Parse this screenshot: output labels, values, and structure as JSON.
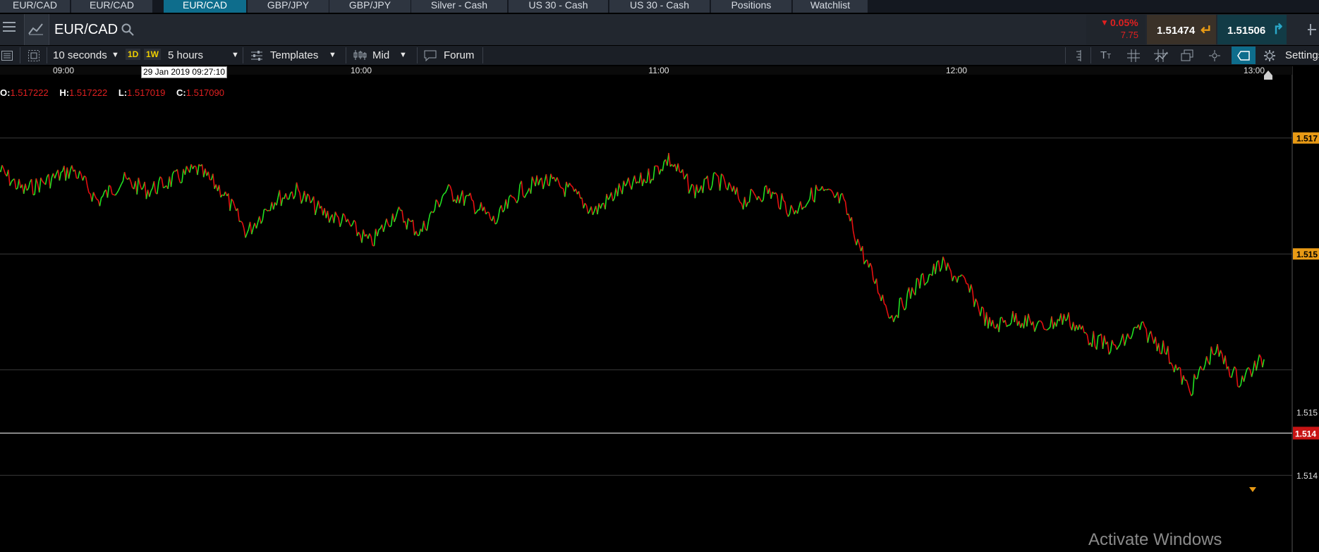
{
  "tabs": [
    {
      "label": "EUR/CAD",
      "active": false
    },
    {
      "label": "EUR/CAD",
      "active": false
    },
    {
      "label": "EUR/CAD",
      "active": true
    },
    {
      "label": "GBP/JPY",
      "active": false
    },
    {
      "label": "GBP/JPY",
      "active": false
    },
    {
      "label": "Silver - Cash",
      "active": false
    },
    {
      "label": "US 30 - Cash",
      "active": false
    },
    {
      "label": "US 30 - Cash",
      "active": false
    },
    {
      "label": "Positions",
      "active": false
    },
    {
      "label": "Watchlist",
      "active": false
    }
  ],
  "header": {
    "instrument": "EUR/CAD",
    "change_pct": "0.05%",
    "change_pts": "7.75",
    "sell_price": "1.51474",
    "buy_price": "1.51506"
  },
  "toolbar": {
    "interval": "10 seconds",
    "range_1d": "1D",
    "range_1w": "1W",
    "duration": "5 hours",
    "templates": "Templates",
    "price_type": "Mid",
    "forum": "Forum",
    "settings": "Settings"
  },
  "ohlc": {
    "o_label": "O:",
    "o_value": "1.517222",
    "h_label": "H:",
    "h_value": "1.517222",
    "l_label": "L:",
    "l_value": "1.517019",
    "c_label": "C:",
    "c_value": "1.517090"
  },
  "crosshair_time": "29 Jan 2019 09:27:10",
  "watermark": "Activate Windows",
  "colors": {
    "up": "#22e122",
    "down": "#e51010",
    "bg": "#000000",
    "accent": "#0e6d8c",
    "price_tag_current": "#c81414",
    "price_tag_level": "#e89a15"
  },
  "chart_data": {
    "type": "line",
    "series_style": "up/down colored price line",
    "x_ticks": [
      "09:00",
      "10:00",
      "11:00",
      "12:00",
      "13:00"
    ],
    "y_ticks": [
      "1.517",
      "1.515",
      "1.515",
      "1.514",
      "1.514"
    ],
    "current_price": "1.514",
    "x": [
      "08:47",
      "08:52",
      "08:57",
      "09:02",
      "09:07",
      "09:12",
      "09:17",
      "09:22",
      "09:27",
      "09:32",
      "09:37",
      "09:42",
      "09:47",
      "09:52",
      "09:57",
      "10:02",
      "10:07",
      "10:12",
      "10:17",
      "10:22",
      "10:27",
      "10:32",
      "10:37",
      "10:42",
      "10:47",
      "10:52",
      "10:57",
      "11:02",
      "11:07",
      "11:12",
      "11:17",
      "11:22",
      "11:27",
      "11:32",
      "11:37",
      "11:42",
      "11:47",
      "11:52",
      "11:57",
      "12:02",
      "12:07",
      "12:12",
      "12:17",
      "12:22",
      "12:27",
      "12:32",
      "12:37",
      "12:42",
      "12:47",
      "12:52",
      "12:57",
      "13:02"
    ],
    "y": [
      1.5172,
      1.517,
      1.5171,
      1.5172,
      1.5169,
      1.5171,
      1.517,
      1.5171,
      1.5172,
      1.517,
      1.5166,
      1.5169,
      1.517,
      1.5168,
      1.5167,
      1.5165,
      1.5168,
      1.5166,
      1.517,
      1.5169,
      1.5167,
      1.517,
      1.5171,
      1.517,
      1.5168,
      1.517,
      1.5171,
      1.5173,
      1.517,
      1.5171,
      1.5169,
      1.517,
      1.5168,
      1.517,
      1.5169,
      1.5163,
      1.5158,
      1.5161,
      1.5163,
      1.5161,
      1.5157,
      1.5158,
      1.5157,
      1.5158,
      1.5156,
      1.5155,
      1.5157,
      1.5155,
      1.5151,
      1.5155,
      1.5152,
      1.5154
    ]
  }
}
